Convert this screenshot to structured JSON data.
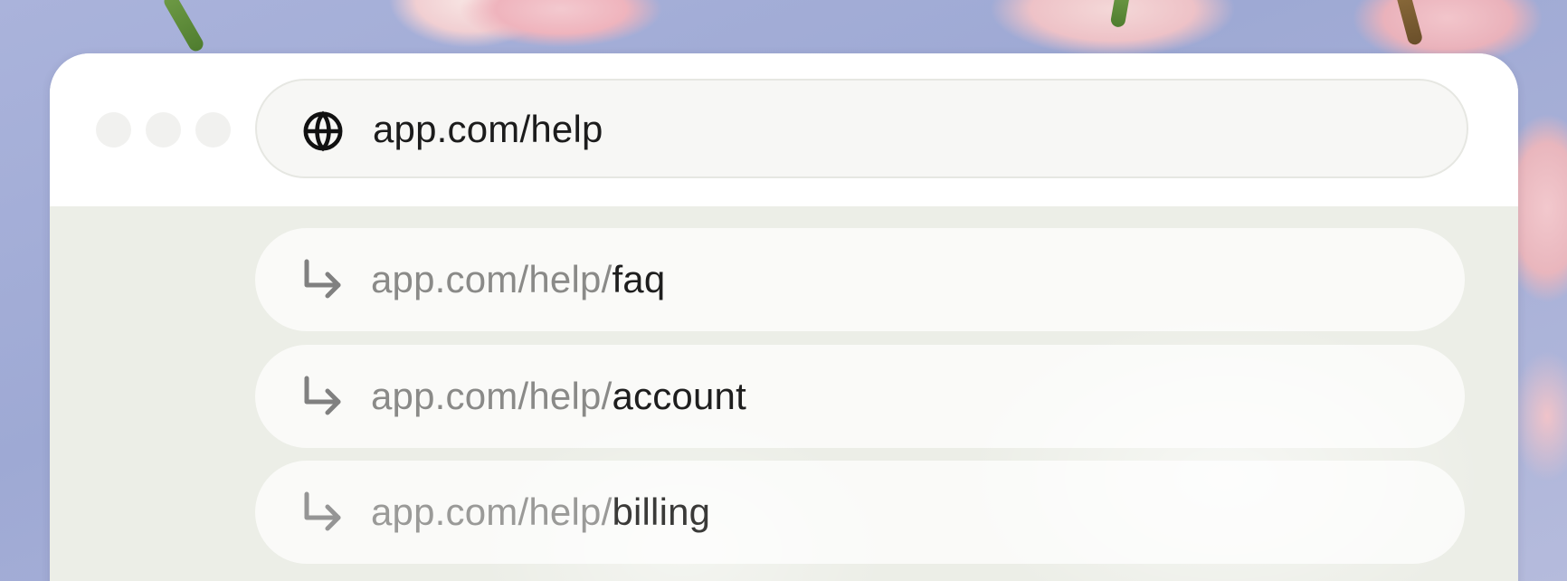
{
  "browser": {
    "address_bar": {
      "icon": "globe-icon",
      "url": "app.com/help"
    },
    "window_controls": [
      "dot",
      "dot",
      "dot"
    ]
  },
  "suggestions": [
    {
      "icon": "return-arrow-icon",
      "prefix": "app.com/help/",
      "suffix": "faq"
    },
    {
      "icon": "return-arrow-icon",
      "prefix": "app.com/help/",
      "suffix": "account"
    },
    {
      "icon": "return-arrow-icon",
      "prefix": "app.com/help/",
      "suffix": "billing"
    }
  ],
  "colors": {
    "background": "#a7b0d6",
    "window": "#ffffff",
    "address_bar": "#f7f7f5",
    "dropdown": "#eceee7",
    "text_primary": "#1c1c1c",
    "text_muted": "#8a8a88"
  }
}
